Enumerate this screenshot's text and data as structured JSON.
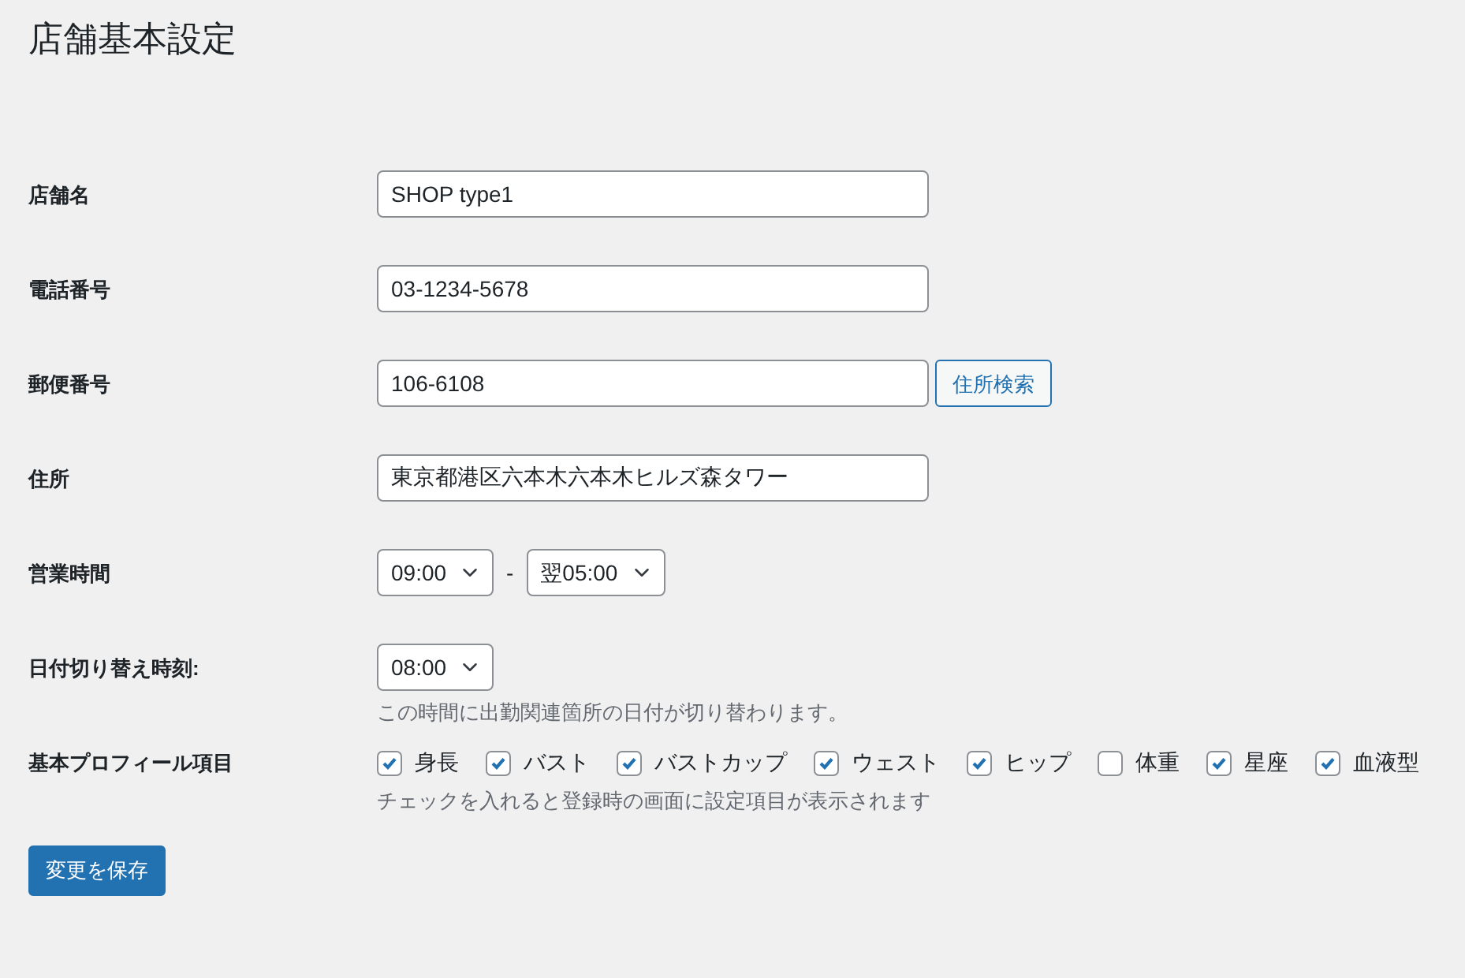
{
  "title": "店舗基本設定",
  "fields": [
    {
      "kind": "text",
      "label": "店舗名",
      "value": "SHOP type1"
    },
    {
      "kind": "text",
      "label": "電話番号",
      "value": "03-1234-5678"
    },
    {
      "kind": "text_button",
      "label": "郵便番号",
      "value": "106-6108",
      "button": "住所検索"
    },
    {
      "kind": "text",
      "label": "住所",
      "value": "東京都港区六本木六本木ヒルズ森タワー"
    },
    {
      "kind": "time_range",
      "label": "営業時間",
      "from": "09:00",
      "separator": "-",
      "to": "翌05:00"
    },
    {
      "kind": "select",
      "label": "日付切り替え時刻:",
      "value": "08:00",
      "description": "この時間に出勤関連箇所の日付が切り替わります。"
    },
    {
      "kind": "checkboxes",
      "label": "基本プロフィール項目",
      "options": [
        {
          "label": "身長",
          "checked": true
        },
        {
          "label": "バスト",
          "checked": true
        },
        {
          "label": "バストカップ",
          "checked": true
        },
        {
          "label": "ウェスト",
          "checked": true
        },
        {
          "label": "ヒップ",
          "checked": true
        },
        {
          "label": "体重",
          "checked": false
        },
        {
          "label": "星座",
          "checked": true
        },
        {
          "label": "血液型",
          "checked": true
        }
      ],
      "description": "チェックを入れると登録時の画面に設定項目が表示されます"
    }
  ],
  "save_button": "変更を保存"
}
